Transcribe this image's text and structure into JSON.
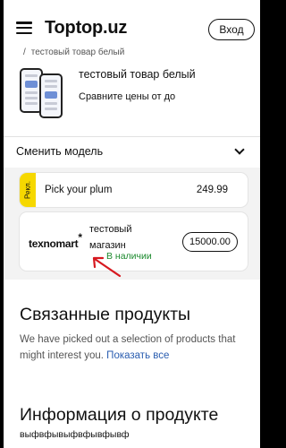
{
  "header": {
    "logo": "Toptop.uz",
    "login_label": "Вход"
  },
  "breadcrumb": {
    "separator": "/",
    "current": "тестовый товар белый"
  },
  "product": {
    "title": "тестовый товар белый",
    "compare_text": "Сравните цены от до"
  },
  "model_selector": {
    "label": "Сменить модель",
    "icon": "chevron-down-icon"
  },
  "ad_offer": {
    "tag": "Рекл.",
    "title": "Pick your plum",
    "price": "249.99",
    "tag_color": "#f6d800"
  },
  "shop_offer": {
    "shop_logo": "texnomart",
    "shop_logo_mark": "*",
    "shop_name": "тестовый магазин",
    "stock_status": "В наличии",
    "price": "15000.00",
    "stock_color": "#1c8a2e"
  },
  "related": {
    "title": "Связанные продукты",
    "description": "We have picked out a selection of products that might interest you.",
    "link": "Показать все"
  },
  "info": {
    "title": "Информация о продукте",
    "text": "выфвфывыфвфывфывф"
  },
  "colors": {
    "arrow": "#d71920",
    "link": "#2a5db0"
  }
}
